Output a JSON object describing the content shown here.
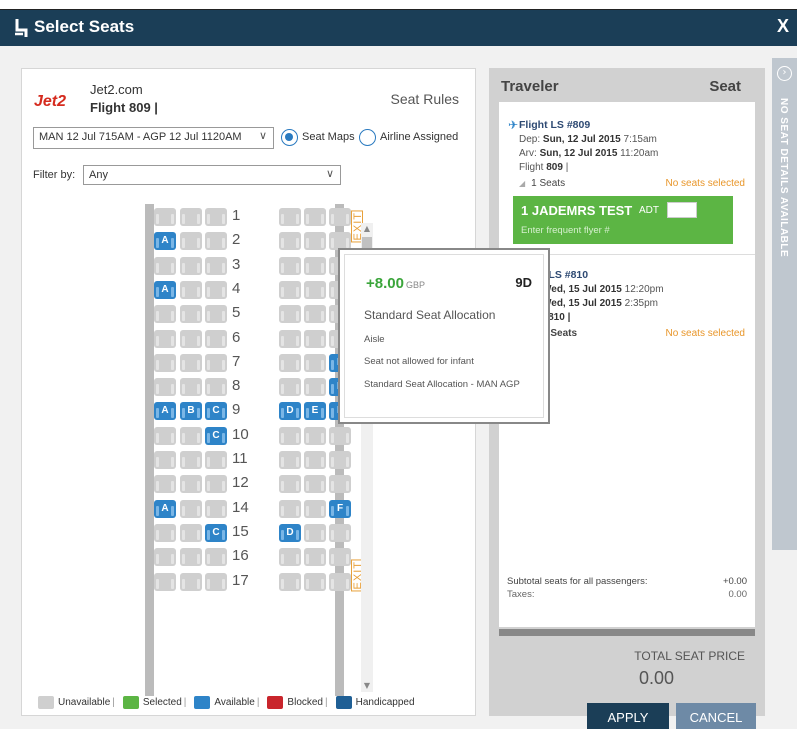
{
  "titlebar": {
    "title": "Select Seats",
    "close": "X"
  },
  "left": {
    "logo": "Jet2",
    "site": "Jet2.com",
    "flight": "Flight 809 |",
    "seat_rules": "Seat Rules",
    "route_select": "MAN 12 Jul 715AM - AGP 12 Jul 1120AM",
    "radio_seat_maps": "Seat Maps",
    "radio_airline_assigned": "Airline Assigned",
    "filter_label": "Filter by:",
    "filter_value": "Any",
    "exit_label": "EXIT"
  },
  "seatmap": {
    "rows": [
      {
        "num": "1",
        "seats": [
          "",
          "",
          "",
          "",
          "",
          ""
        ]
      },
      {
        "num": "2",
        "seats": [
          "A",
          "",
          "",
          "",
          "",
          ""
        ]
      },
      {
        "num": "3",
        "seats": [
          "",
          "",
          "",
          "",
          "",
          ""
        ]
      },
      {
        "num": "4",
        "seats": [
          "A",
          "",
          "",
          "",
          "",
          ""
        ]
      },
      {
        "num": "5",
        "seats": [
          "",
          "",
          "",
          "",
          "",
          ""
        ]
      },
      {
        "num": "6",
        "seats": [
          "",
          "",
          "",
          "",
          "",
          ""
        ]
      },
      {
        "num": "7",
        "seats": [
          "",
          "",
          "",
          "",
          "",
          "F"
        ]
      },
      {
        "num": "8",
        "seats": [
          "",
          "",
          "",
          "",
          "",
          "F"
        ]
      },
      {
        "num": "9",
        "seats": [
          "A",
          "B",
          "C",
          "D",
          "E",
          "F"
        ]
      },
      {
        "num": "10",
        "seats": [
          "",
          "",
          "C",
          "",
          "",
          ""
        ]
      },
      {
        "num": "11",
        "seats": [
          "",
          "",
          "",
          "",
          "",
          ""
        ]
      },
      {
        "num": "12",
        "seats": [
          "",
          "",
          "",
          "",
          "",
          ""
        ]
      },
      {
        "num": "14",
        "seats": [
          "A",
          "",
          "",
          "",
          "",
          "F"
        ]
      },
      {
        "num": "15",
        "seats": [
          "",
          "",
          "C",
          "D",
          "",
          ""
        ]
      },
      {
        "num": "16",
        "seats": [
          "",
          "",
          "",
          "",
          "",
          ""
        ]
      },
      {
        "num": "17",
        "seats": [
          "",
          "",
          "",
          "",
          "",
          ""
        ]
      }
    ]
  },
  "legend": {
    "unavailable": "Unavailable",
    "selected": "Selected",
    "available": "Available",
    "blocked": "Blocked",
    "handicapped": "Handicapped",
    "sep": "|"
  },
  "tooltip": {
    "price": "+8.00",
    "currency": "GBP",
    "seat": "9D",
    "title": "Standard Seat Allocation",
    "line1": "Aisle",
    "line2": "Seat not allowed for infant",
    "line3": "Standard Seat Allocation - MAN AGP"
  },
  "right": {
    "traveler_header": "Traveler",
    "seat_header": "Seat",
    "flight1": {
      "title": "Flight LS #809",
      "dep_label": "Dep:",
      "dep": "Sun, 12 Jul 2015",
      "dep_time": "7:15am",
      "arv_label": "Arv:",
      "arv": "Sun, 12 Jul 2015",
      "arv_time": "11:20am",
      "flight": "Flight",
      "flight_no": "809",
      "flight_suffix": "|",
      "seats": "1 Seats",
      "no_seats": "No seats selected"
    },
    "traveler": {
      "name": "1 JADEMRS TEST",
      "type": "ADT",
      "ff_placeholder": "Enter frequent flyer #"
    },
    "flight2": {
      "title": "t LS #810",
      "dep": "Wed, 15 Jul 2015",
      "dep_time": "12:20pm",
      "arv": "Wed, 15 Jul 2015",
      "arv_time": "2:35pm",
      "flight_no": ": 810 |",
      "seats": "1 Seats",
      "no_seats": "No seats selected"
    },
    "subtotal_label": "Subtotal seats for all passengers:",
    "subtotal_value": "+0.00",
    "taxes_label": "Taxes:",
    "taxes_value": "0.00",
    "total_label": "TOTAL SEAT PRICE",
    "total_value": "0.00",
    "apply": "APPLY",
    "cancel": "CANCEL"
  },
  "sidetab": {
    "text": "NO SEAT DETAILS AVAILABLE"
  },
  "colors": {
    "titlebar": "#1b3e57",
    "available": "#2e84c8",
    "unavailable": "#cfcfcf",
    "selected": "#5cb544",
    "blocked": "#c9252c",
    "handicapped": "#1f5f95",
    "exit": "#e8a03a",
    "price": "#3aa53a",
    "no_seats": "#e8962a"
  }
}
